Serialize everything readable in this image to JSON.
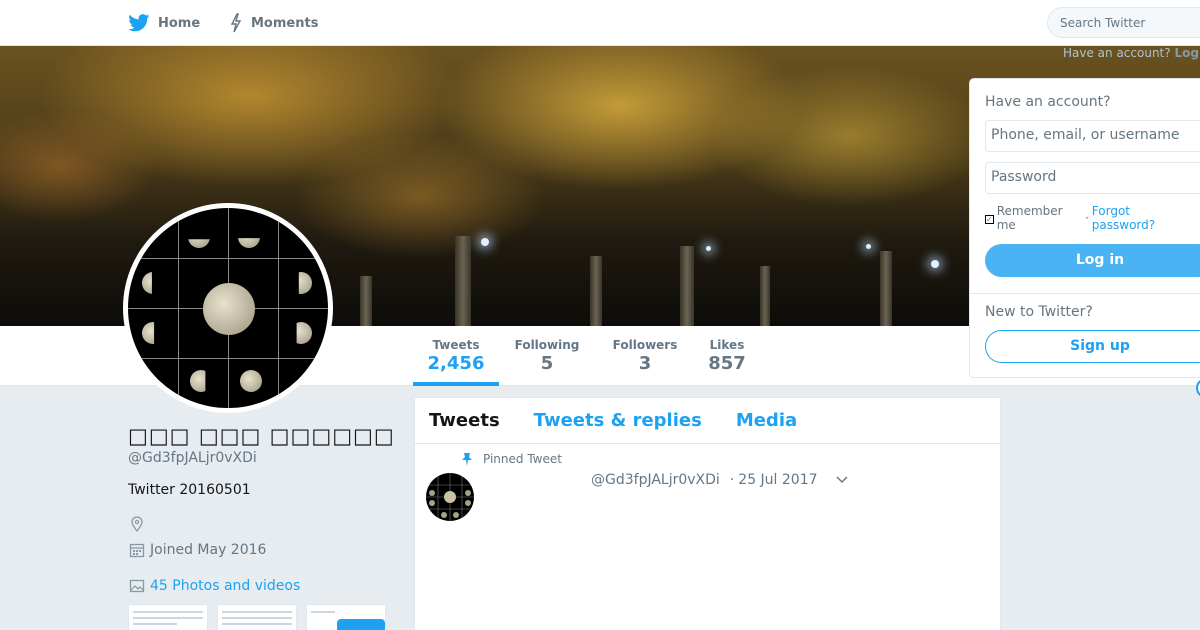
{
  "nav": {
    "home_label": "Home",
    "moments_label": "Moments",
    "home_icon": "twitter-bird-icon",
    "moments_icon": "lightning-icon",
    "brand_color": "#1da1f2"
  },
  "search": {
    "placeholder": "Search Twitter"
  },
  "top_login_hint": {
    "text": "Have an account?",
    "link": "Log"
  },
  "profile_nav": {
    "stats": [
      {
        "label": "Tweets",
        "value": "2,456",
        "active": true
      },
      {
        "label": "Following",
        "value": "5"
      },
      {
        "label": "Followers",
        "value": "3"
      },
      {
        "label": "Likes",
        "value": "857"
      }
    ]
  },
  "login": {
    "heading": "Have an account?",
    "username_placeholder": "Phone, email, or username",
    "password_placeholder": "Password",
    "remember_label": "Remember me",
    "separator": "·",
    "forgot_label": "Forgot password?",
    "login_button": "Log in",
    "new_heading": "New to Twitter?",
    "signup_button": "Sign up"
  },
  "profile": {
    "name": "□□□ □□□ □□□□□□",
    "handle": "@Gd3fpJALjr0vXDi",
    "bio": "Twitter 20160501",
    "joined": "Joined May 2016",
    "photos_label": "45 Photos and videos"
  },
  "timeline": {
    "tabs": [
      {
        "label": "Tweets",
        "active": true
      },
      {
        "label": "Tweets & replies"
      },
      {
        "label": "Media"
      }
    ],
    "pinned_label": "Pinned Tweet",
    "tweet": {
      "handle": "@Gd3fpJALjr0vXDi",
      "separator": "·",
      "date": "25 Jul 2017"
    }
  }
}
